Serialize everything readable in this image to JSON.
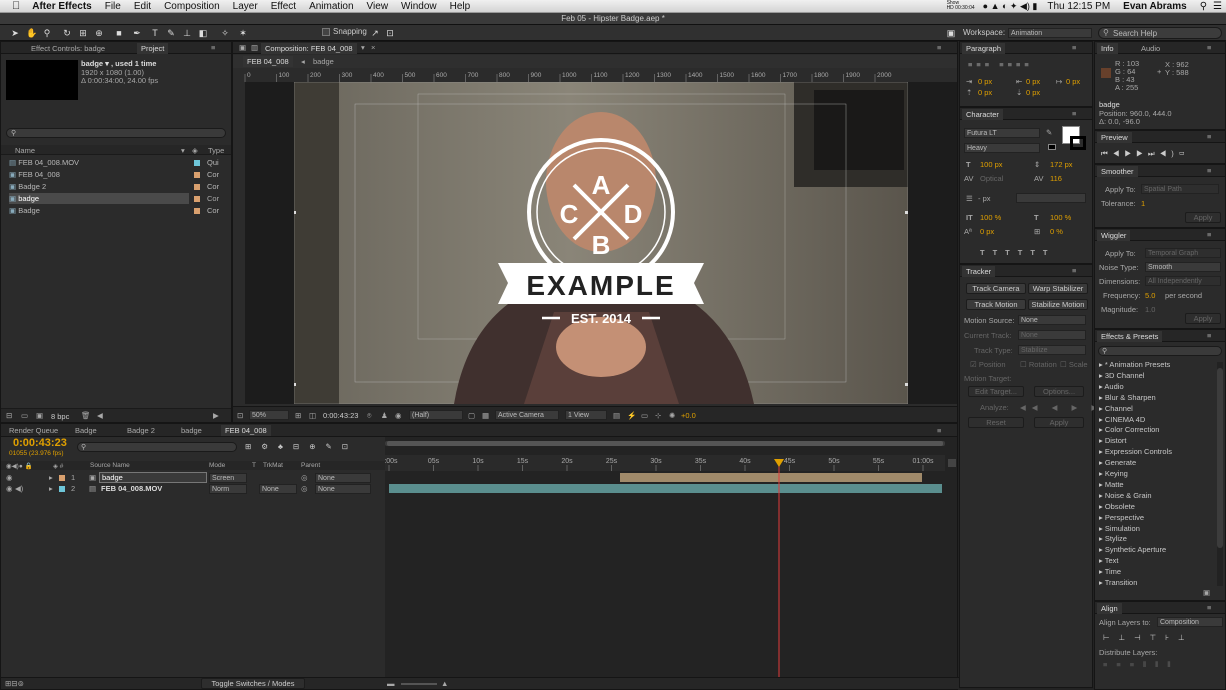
{
  "menubar": {
    "apple": "",
    "app": "After Effects",
    "menus": [
      "File",
      "Edit",
      "Composition",
      "Layer",
      "Effect",
      "Animation",
      "View",
      "Window",
      "Help"
    ],
    "menu_extra": "Show\nHD 00:30:04",
    "time": "Thu 12:15 PM",
    "user": "Evan Abrams"
  },
  "window_title": "Feb 05 - Hipster Badge.aep *",
  "toolbar": {
    "snapping": "Snapping",
    "workspace_label": "Workspace:",
    "workspace_value": "Animation",
    "search_help": "Search Help"
  },
  "project": {
    "tab_effect_controls": "Effect Controls: badge",
    "tab_project": "Project",
    "selected_name": "badge ▾ , used 1 time",
    "selected_info1": "1920 x 1080 (1.00)",
    "selected_info2": "Δ 0:00:34:00, 24.00 fps",
    "col_name": "Name",
    "col_type": "Type",
    "items": [
      {
        "name": "FEB 04_008.MOV",
        "type": "Qui",
        "color": "#6ec6d9"
      },
      {
        "name": "FEB 04_008",
        "type": "Cor",
        "color": "#d9a06e"
      },
      {
        "name": "Badge 2",
        "type": "Cor",
        "color": "#d9a06e"
      },
      {
        "name": "badge",
        "type": "Cor",
        "color": "#d9a06e"
      },
      {
        "name": "Badge",
        "type": "Cor",
        "color": "#d9a06e"
      }
    ],
    "bpc": "8 bpc"
  },
  "composition": {
    "tab": "Composition: FEB 04_008",
    "crumb1": "FEB 04_008",
    "crumb2": "badge",
    "ruler": [
      "0",
      "100",
      "200",
      "300",
      "400",
      "500",
      "600",
      "700",
      "800",
      "900",
      "1000",
      "1100",
      "1200",
      "1300",
      "1400",
      "1500",
      "1600",
      "1700",
      "1800",
      "1900",
      "2000"
    ],
    "badge_letters": {
      "top": "A",
      "left": "C",
      "right": "D",
      "bottom": "B"
    },
    "badge_main": "EXAMPLE",
    "badge_est": "EST. 2014",
    "zoom": "50%",
    "timecode": "0:00:43:23",
    "resolution": "(Half)",
    "camera": "Active Camera",
    "views": "1 View",
    "exposure": "+0.0"
  },
  "paragraph": {
    "title": "Paragraph",
    "indent1": "0 px",
    "indent2": "0 px",
    "indent3": "0 px",
    "space1": "0 px",
    "space2": "0 px"
  },
  "character": {
    "title": "Character",
    "font": "Futura LT",
    "style": "Heavy",
    "size": "100 px",
    "leading": "172 px",
    "kerning": "Optical",
    "tracking": "116",
    "stroke": "- px",
    "vscale": "100 %",
    "hscale": "100 %",
    "baseline": "0 px",
    "tsume": "0 %",
    "fill_color": "#ffffff",
    "stroke_color": "#000000"
  },
  "tracker": {
    "title": "Tracker",
    "track_camera": "Track Camera",
    "warp_stabilizer": "Warp Stabilizer",
    "track_motion": "Track Motion",
    "stabilize_motion": "Stabilize Motion",
    "motion_source_label": "Motion Source:",
    "motion_source": "None",
    "current_track_label": "Current Track:",
    "current_track": "None",
    "track_type_label": "Track Type:",
    "track_type": "Stabilize",
    "position": "Position",
    "rotation": "Rotation",
    "scale": "Scale",
    "motion_target": "Motion Target:",
    "edit_target": "Edit Target...",
    "options": "Options...",
    "analyze": "Analyze:",
    "reset": "Reset",
    "apply": "Apply"
  },
  "info": {
    "tab_info": "Info",
    "tab_audio": "Audio",
    "r": "R : 103",
    "g": "G : 64",
    "b": "B : 43",
    "a": "A : 255",
    "x": "X : 962",
    "y": "Y : 588",
    "swatch": "#67402b",
    "layer": "badge",
    "position": "Position: 960.0, 444.0",
    "delta": "Δ: 0.0, -96.0"
  },
  "preview": {
    "title": "Preview"
  },
  "smoother": {
    "title": "Smoother",
    "apply_to_label": "Apply To:",
    "apply_to": "Spatial Path",
    "tolerance_label": "Tolerance:",
    "tolerance": "1",
    "apply": "Apply"
  },
  "wiggler": {
    "title": "Wiggler",
    "apply_to_label": "Apply To:",
    "apply_to": "Temporal Graph",
    "noise_label": "Noise Type:",
    "noise": "Smooth",
    "dimensions_label": "Dimensions:",
    "dimensions": "All Independently",
    "frequency_label": "Frequency:",
    "frequency": "5.0",
    "per_second": "per second",
    "magnitude_label": "Magnitude:",
    "magnitude": "1.0",
    "apply": "Apply"
  },
  "effects": {
    "title": "Effects & Presets",
    "items": [
      "* Animation Presets",
      "3D Channel",
      "Audio",
      "Blur & Sharpen",
      "Channel",
      "CINEMA 4D",
      "Color Correction",
      "Distort",
      "Expression Controls",
      "Generate",
      "Keying",
      "Matte",
      "Noise & Grain",
      "Obsolete",
      "Perspective",
      "Simulation",
      "Stylize",
      "Synthetic Aperture",
      "Text",
      "Time",
      "Transition"
    ]
  },
  "align": {
    "title": "Align",
    "align_layers_label": "Align Layers to:",
    "align_layers": "Composition",
    "distribute": "Distribute Layers:"
  },
  "timeline": {
    "tabs": [
      "Render Queue",
      "Badge",
      "Badge 2",
      "badge",
      "FEB 04_008"
    ],
    "timecode": "0:00:43:23",
    "frames": "01055 (23.976 fps)",
    "col_source": "Source Name",
    "col_mode": "Mode",
    "col_t": "T",
    "col_trkmat": "TrkMat",
    "col_parent": "Parent",
    "ticks": [
      "0:00s",
      "05s",
      "10s",
      "15s",
      "20s",
      "25s",
      "30s",
      "35s",
      "40s",
      "45s",
      "50s",
      "55s",
      "01:00s"
    ],
    "layers": [
      {
        "num": "1",
        "name": "badge",
        "mode": "Screen",
        "trkmat": "",
        "parent": "None"
      },
      {
        "num": "2",
        "name": "FEB 04_008.MOV",
        "mode": "Norm",
        "trkmat": "None",
        "parent": "None"
      }
    ],
    "toggle": "Toggle Switches / Modes"
  }
}
